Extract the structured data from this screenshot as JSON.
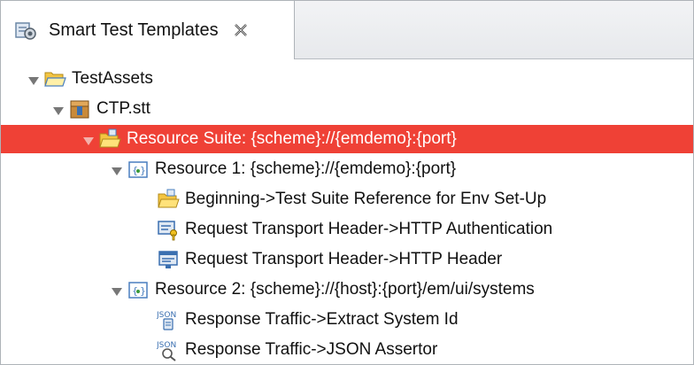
{
  "tab": {
    "title": "Smart Test Templates",
    "icon": "smart-test-templates-icon"
  },
  "tree": {
    "nodes": [
      {
        "label": "TestAssets",
        "icon": "folder-open-icon",
        "expanded": true
      },
      {
        "label": "CTP.stt",
        "icon": "stt-file-icon",
        "expanded": true
      },
      {
        "label": "Resource Suite: {scheme}://{emdemo}:{port}",
        "icon": "suite-folder-icon",
        "expanded": true,
        "selected": true
      },
      {
        "label": "Resource 1: {scheme}://{emdemo}:{port}",
        "icon": "resource-icon",
        "expanded": true
      },
      {
        "label": "Beginning->Test Suite Reference for Env Set-Up",
        "icon": "suite-reference-icon"
      },
      {
        "label": "Request Transport Header->HTTP Authentication",
        "icon": "http-authentication-icon"
      },
      {
        "label": "Request Transport Header->HTTP Header",
        "icon": "http-header-icon"
      },
      {
        "label": "Resource 2: {scheme}://{host}:{port}/em/ui/systems",
        "icon": "resource-icon",
        "expanded": true
      },
      {
        "label": "Response Traffic->Extract System Id",
        "icon": "json-extract-icon"
      },
      {
        "label": "Response Traffic->JSON Assertor",
        "icon": "json-assertor-icon"
      }
    ]
  },
  "colors": {
    "selection": "#ef4136",
    "folder": "#f4c542"
  }
}
